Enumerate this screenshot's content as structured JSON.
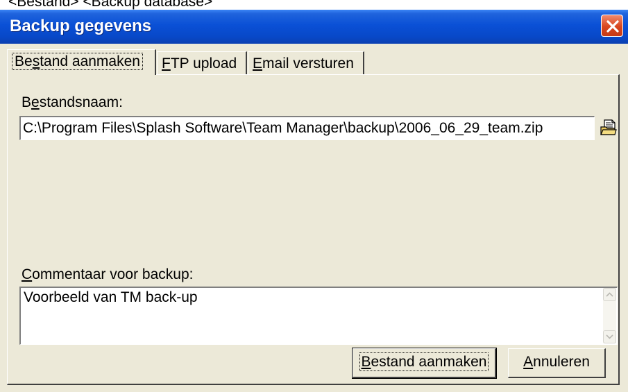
{
  "page_caption": "<Bestand> <Backup database>",
  "window": {
    "title": "Backup gegevens",
    "close_icon": "close-icon"
  },
  "tabs": [
    {
      "label_pre": "Be",
      "label_key": "s",
      "label_post": "tand aanmaken",
      "active": true
    },
    {
      "label_pre": "",
      "label_key": "F",
      "label_post": "TP upload",
      "active": false
    },
    {
      "label_pre": "",
      "label_key": "E",
      "label_post": "mail versturen",
      "active": false
    }
  ],
  "file_section": {
    "label_pre": "B",
    "label_key": "e",
    "label_post": "standsnaam:",
    "value": "C:\\Program Files\\Splash Software\\Team Manager\\backup\\2006_06_29_team.zip",
    "browse_icon": "browse-folder-icon"
  },
  "comment_section": {
    "label_key": "C",
    "label_post": "ommentaar voor backup:",
    "value": "Voorbeeld van TM back-up"
  },
  "buttons": {
    "create_key": "B",
    "create_post": "estand aanmaken",
    "cancel_pre": "",
    "cancel_key": "A",
    "cancel_post": "nnuleren"
  },
  "colors": {
    "titlebar": "#0a50d6",
    "close": "#d8461e",
    "face": "#ece9d8"
  }
}
